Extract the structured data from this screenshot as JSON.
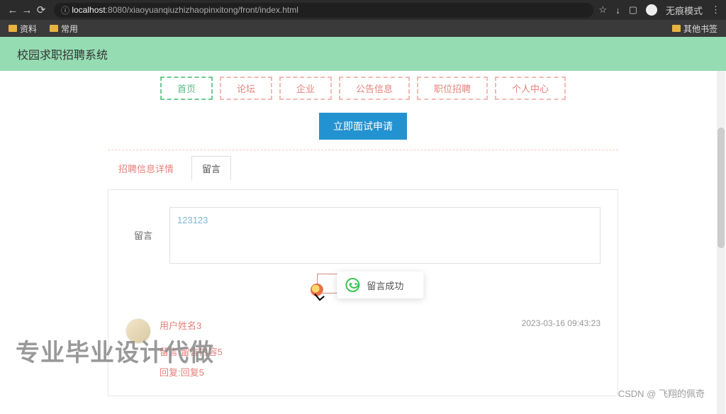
{
  "browser": {
    "url_prefix": "localhost",
    "url_rest": ":8080/xiaoyuanqiuzhizhaopinxitong/front/index.html",
    "incognito": "无痕模式",
    "star": "☆",
    "download": "↓",
    "square": "▢",
    "dots": "⋮"
  },
  "bookmarks": {
    "items": [
      "资料",
      "常用"
    ],
    "other": "其他书签"
  },
  "site": {
    "title": "校园求职招聘系统"
  },
  "nav": [
    "首页",
    "论坛",
    "企业",
    "公告信息",
    "职位招聘",
    "个人中心"
  ],
  "action_button": "立即面试申请",
  "tabs": [
    "招聘信息详情",
    "留言"
  ],
  "form": {
    "label": "留言",
    "value": "123123"
  },
  "toast": "留言成功",
  "comment": {
    "name": "用户姓名3",
    "time": "2023-03-16 09:43:23",
    "body": "留言:留言内容5",
    "reply": "回复:回复5"
  },
  "watermark": {
    "big": "专业毕业设计代做",
    "small": "CSDN @ 飞翔的佩奇"
  }
}
